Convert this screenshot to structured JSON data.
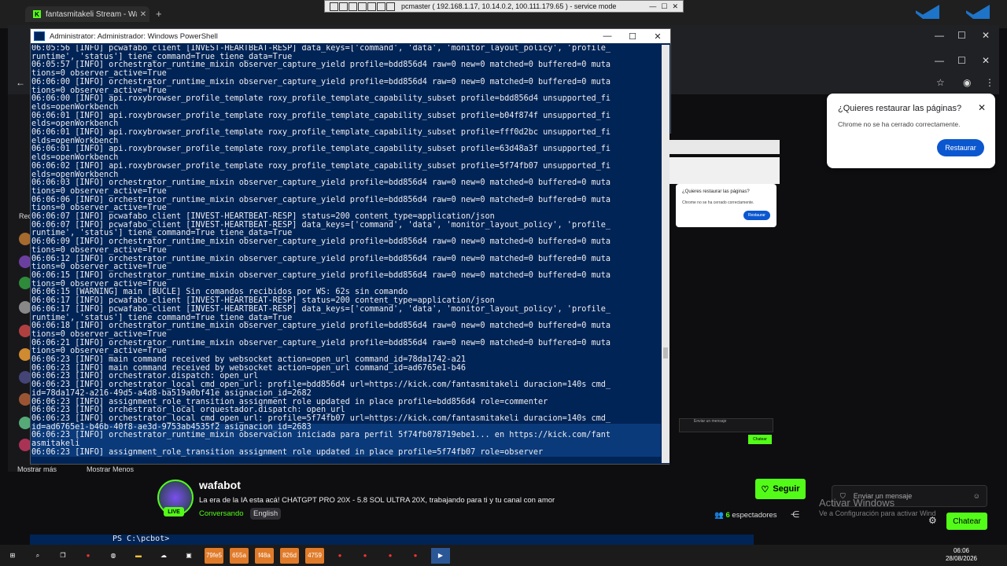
{
  "browser_tab": {
    "title": "fantasmitakeli Stream - Watch",
    "close": "✕",
    "new_tab": "+"
  },
  "remote_bar": {
    "title": "pcmaster ( 192.168.1.17, 10.14.0.2, 100.111.179.65 ) - service mode",
    "minimize": "—",
    "maximize": "☐",
    "close": "✕"
  },
  "powershell": {
    "title": "Administrator: Administrador: Windows PowerShell",
    "lines": [
      "06:05:56 [INFO] pcwafabo_client [INVEST-HEARTBEAT-RESP] data_keys=['command', 'data', 'monitor_layout_policy', 'profile_",
      "runtime', 'status'] tiene_command=True tiene_data=True",
      "06:05:57 [INFO] orchestrator_runtime_mixin observer_capture_yield profile=bdd856d4 raw=0 new=0 matched=0 buffered=0 muta",
      "tions=0 observer_active=True",
      "06:06:00 [INFO] orchestrator_runtime_mixin observer_capture_yield profile=bdd856d4 raw=0 new=0 matched=0 buffered=0 muta",
      "tions=0 observer_active=True",
      "06:06:00 [INFO] api.roxybrowser_profile_template roxy_profile_template_capability_subset profile=bdd856d4 unsupported_fi",
      "elds=openWorkbench",
      "06:06:01 [INFO] api.roxybrowser_profile_template roxy_profile_template_capability_subset profile=b04f874f unsupported_fi",
      "elds=openWorkbench",
      "06:06:01 [INFO] api.roxybrowser_profile_template roxy_profile_template_capability_subset profile=fff0d2bc unsupported_fi",
      "elds=openWorkbench",
      "06:06:01 [INFO] api.roxybrowser_profile_template roxy_profile_template_capability_subset profile=63d48a3f unsupported_fi",
      "elds=openWorkbench",
      "06:06:02 [INFO] api.roxybrowser_profile_template roxy_profile_template_capability_subset profile=5f74fb07 unsupported_fi",
      "elds=openWorkbench",
      "06:06:03 [INFO] orchestrator_runtime_mixin observer_capture_yield profile=bdd856d4 raw=0 new=0 matched=0 buffered=0 muta",
      "tions=0 observer_active=True",
      "06:06:06 [INFO] orchestrator_runtime_mixin observer_capture_yield profile=bdd856d4 raw=0 new=0 matched=0 buffered=0 muta",
      "tions=0 observer_active=True",
      "06:06:07 [INFO] pcwafabo_client [INVEST-HEARTBEAT-RESP] status=200 content_type=application/json",
      "06:06:07 [INFO] pcwafabo_client [INVEST-HEARTBEAT-RESP] data_keys=['command', 'data', 'monitor_layout_policy', 'profile_",
      "runtime', 'status'] tiene_command=True tiene_data=True",
      "06:06:09 [INFO] orchestrator_runtime_mixin observer_capture_yield profile=bdd856d4 raw=0 new=0 matched=0 buffered=0 muta",
      "tions=0 observer_active=True",
      "06:06:12 [INFO] orchestrator_runtime_mixin observer_capture_yield profile=bdd856d4 raw=0 new=0 matched=0 buffered=0 muta",
      "tions=0 observer_active=True",
      "06:06:15 [INFO] orchestrator_runtime_mixin observer_capture_yield profile=bdd856d4 raw=0 new=0 matched=0 buffered=0 muta",
      "tions=0 observer_active=True",
      "06:06:15 [WARNING] main [BUCLE] Sin comandos recibidos por WS: 62s sin comando",
      "06:06:17 [INFO] pcwafabo_client [INVEST-HEARTBEAT-RESP] status=200 content_type=application/json",
      "06:06:17 [INFO] pcwafabo_client [INVEST-HEARTBEAT-RESP] data_keys=['command', 'data', 'monitor_layout_policy', 'profile_",
      "runtime', 'status'] tiene_command=True tiene_data=True",
      "06:06:18 [INFO] orchestrator_runtime_mixin observer_capture_yield profile=bdd856d4 raw=0 new=0 matched=0 buffered=0 muta",
      "tions=0 observer_active=True",
      "06:06:21 [INFO] orchestrator_runtime_mixin observer_capture_yield profile=bdd856d4 raw=0 new=0 matched=0 buffered=0 muta",
      "tions=0 observer_active=True",
      "06:06:23 [INFO] main command received by websocket action=open_url command_id=78da1742-a21",
      "06:06:23 [INFO] main command received by websocket action=open_url command_id=ad6765e1-b46",
      "06:06:23 [INFO] orchestrator.dispatch: open_url",
      "06:06:23 [INFO] orchestrator_local cmd_open_url: profile=bdd856d4 url=https://kick.com/fantasmitakeli duracion=140s cmd_",
      "id=78da1742-a216-49d5-a4d8-ba519a0bf41e asignacion_id=2682",
      "06:06:23 [INFO] assignment_role_transition assignment role updated in place profile=bdd856d4 role=commenter",
      "06:06:23 [INFO] orchestrator_local orquestador.dispatch: open_url",
      "06:06:23 [INFO] orchestrator_local cmd_open_url: profile=5f74fb07 url=https://kick.com/fantasmitakeli duracion=140s cmd_",
      "id=ad6765e1-b46b-40f8-ae3d-9753ab4535f2 asignacion_id=2683",
      "06:06:23 [INFO] orchestrator_runtime_mixin observacion iniciada para perfil 5f74fb078719ebe1... en https://kick.com/fant",
      "asmitakeli",
      "06:06:23 [INFO] assignment_role_transition assignment role updated in place profile=5f74fb07 role=observer"
    ],
    "prompt": "PS C:\\pcbot>"
  },
  "restore_popup": {
    "heading": "¿Quieres restaurar las páginas?",
    "body": "Chrome no se ha cerrado correctamente.",
    "button": "Restaurar"
  },
  "mini_popup": {
    "heading": "¿Quieres restaurar las páginas?",
    "body": "Chrome no se ha cerrado correctamente.",
    "button": "Restaurar"
  },
  "sidebar": {
    "recommended": "Rec",
    "show_more": "Mostrar más",
    "show_less": "Mostrar Menos"
  },
  "channel": {
    "name": "wafabot",
    "title": "La era de la  IA esta acá! CHATGPT PRO 20X - 5.8 SOL ULTRA 20X, trabajando para ti y tu canal con amor",
    "category": "Conversando",
    "language": "English",
    "live": "LIVE",
    "follow": "Seguir",
    "viewers_count": "6",
    "viewers_label": "espectadores"
  },
  "chat": {
    "placeholder": "Enviar un mensaje",
    "send": "Chatear"
  },
  "watermark": {
    "line1": "Activar Windows",
    "line2": "Ve a Configuración para activar Wind"
  },
  "taskbar": {
    "apps": [
      "79fe5",
      "655a",
      "f48a",
      "826d",
      "4759"
    ],
    "time": "06:06",
    "date": "28/08/2026"
  },
  "colors": {
    "kick_green": "#53fc18",
    "ps_blue": "#012456",
    "chrome_blue": "#0b57d0"
  }
}
